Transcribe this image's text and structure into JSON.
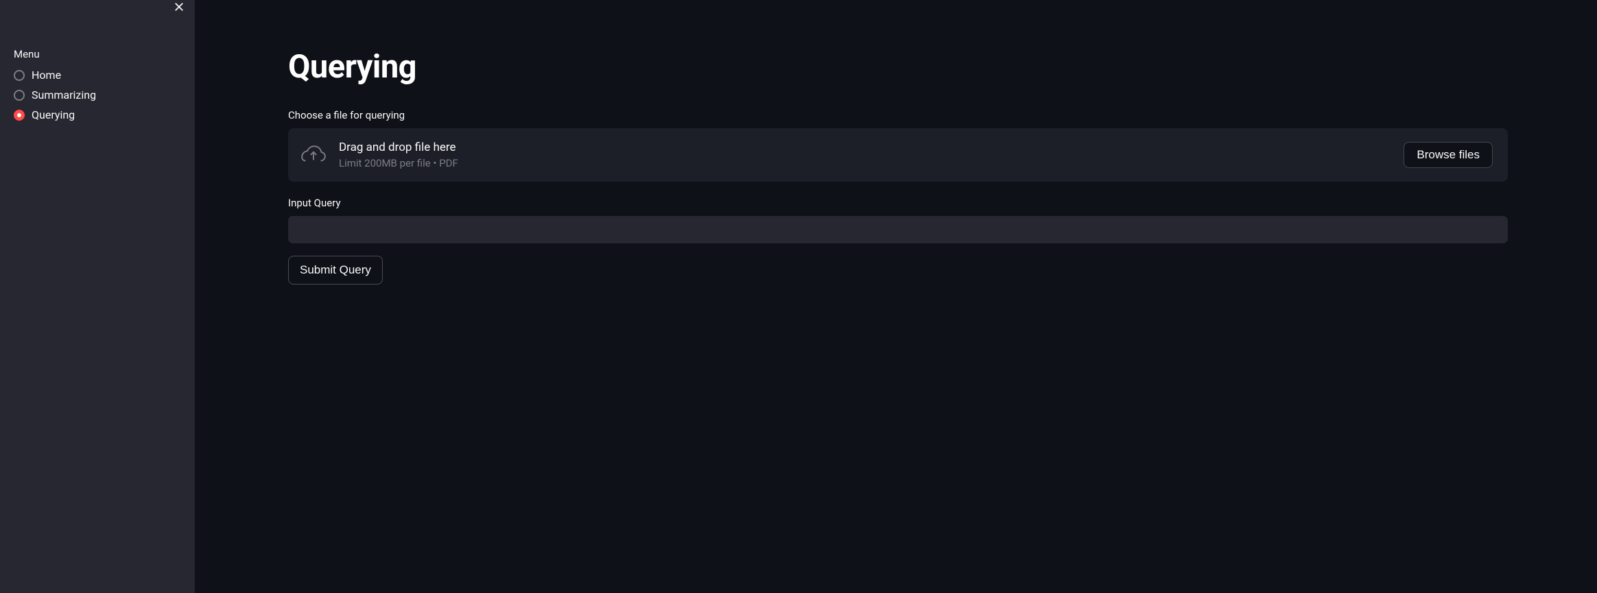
{
  "sidebar": {
    "menu_heading": "Menu",
    "items": [
      {
        "label": "Home",
        "selected": false
      },
      {
        "label": "Summarizing",
        "selected": false
      },
      {
        "label": "Querying",
        "selected": true
      }
    ]
  },
  "main": {
    "title": "Querying",
    "file_section_label": "Choose a file for querying",
    "uploader": {
      "title": "Drag and drop file here",
      "subtext": "Limit 200MB per file • PDF",
      "browse_label": "Browse files"
    },
    "query_section_label": "Input Query",
    "query_value": "",
    "submit_label": "Submit Query"
  }
}
